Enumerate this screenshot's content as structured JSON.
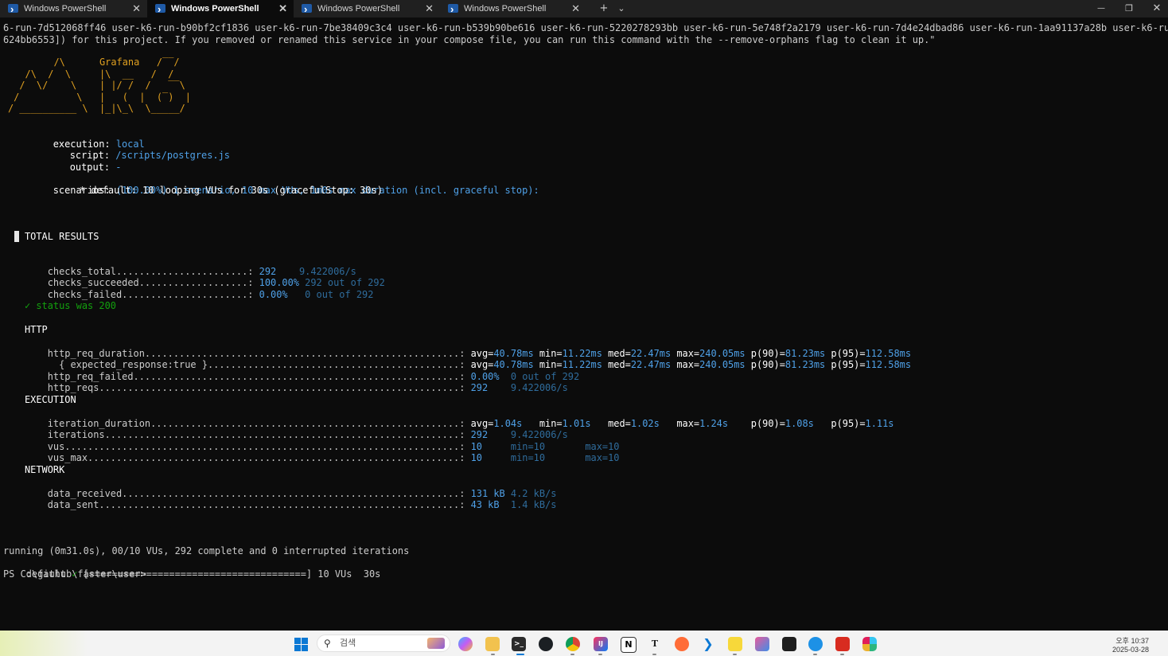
{
  "tabs": [
    {
      "title": "Windows PowerShell",
      "icon": "powershell-icon"
    },
    {
      "title": "Windows PowerShell",
      "icon": "powershell-icon"
    },
    {
      "title": "Windows PowerShell",
      "icon": "powershell-icon"
    },
    {
      "title": "Windows PowerShell",
      "icon": "powershell-icon"
    }
  ],
  "tabbar": {
    "new_tab": "+",
    "dropdown": "⌄",
    "minimize": "—",
    "restore": "❐",
    "close": "✕",
    "tab_close": "✕"
  },
  "terminal": {
    "warning_line1": "6-run-7d512068ff46 user-k6-run-b90bf2cf1836 user-k6-run-7be38409c3c4 user-k6-run-b539b90be616 user-k6-run-5220278293bb user-k6-run-5e748f2a2179 user-k6-run-7d4e24dbad86 user-k6-run-1aa91137a28b user-k6-run-fec",
    "warning_line2": "624bb6553]) for this project. If you removed or renamed this service in your compose file, you can run this command with the --remove-orphans flag to clean it up.\"",
    "logo": [
      "        /\\      Grafana   /‾‾/",
      "   /\\  /  \\     |\\  __   /  /",
      "  /  \\/    \\    | |/ /  /   ‾‾\\",
      " /          \\   |   (  |  (‾)  |",
      "/ __________ \\  |_|\\_\\  \\_____/"
    ],
    "execution_label": "execution:",
    "execution_value": "local",
    "script_label": "script:",
    "script_value": "/scripts/postgres.js",
    "output_label": "output:",
    "output_value": "-",
    "scenarios_label": "scenarios:",
    "scenarios_value": "(100.00%) 1 scenario, 10 max VUs, 1m0s max duration (incl. graceful stop):",
    "scenario_default": "* default: 10 looping VUs for 30s (gracefulStop: 30s)",
    "total_results": "TOTAL RESULTS",
    "checks": [
      {
        "name": "checks_total.......................:",
        "value": "292",
        "extra": "    9.422006/s"
      },
      {
        "name": "checks_succeeded...................:",
        "value": "100.00%",
        "extra": " 292 out of 292"
      },
      {
        "name": "checks_failed......................:",
        "value": "0.00%",
        "extra": "   0 out of 292"
      }
    ],
    "status_check": "✓ status was 200",
    "http_header": "HTTP",
    "http_req_duration_name": "http_req_duration.......................................................:",
    "expected_response_name": "  { expected_response:true }............................................:",
    "http_req_duration_stats": {
      "avg": "40.78ms",
      "min": "11.22ms",
      "med": "22.47ms",
      "max": "240.05ms",
      "p90": "81.23ms",
      "p95": "112.58ms"
    },
    "expected_response_stats": {
      "avg": "40.78ms",
      "min": "11.22ms",
      "med": "22.47ms",
      "max": "240.05ms",
      "p90": "81.23ms",
      "p95": "112.58ms"
    },
    "http_req_failed_name": "http_req_failed.........................................................:",
    "http_req_failed_value": "0.00%",
    "http_req_failed_extra": "  0 out of 292",
    "http_reqs_name": "http_reqs...............................................................:",
    "http_reqs_value": "292",
    "http_reqs_extra": "    9.422006/s",
    "execution_header": "EXECUTION",
    "iteration_duration_name": "iteration_duration......................................................:",
    "iteration_duration_stats": {
      "avg": "1.04s",
      "min": "1.01s",
      "med": "1.02s",
      "max": "1.24s",
      "p90": "1.08s",
      "p95": "1.11s"
    },
    "iterations_name": "iterations..............................................................:",
    "iterations_value": "292",
    "iterations_extra": "    9.422006/s",
    "vus_name": "vus.....................................................................:",
    "vus_value": "10",
    "vus_extra": "     min=10       max=10",
    "vus_max_name": "vus_max.................................................................:",
    "vus_max_value": "10",
    "vus_max_extra": "     min=10       max=10",
    "network_header": "NETWORK",
    "data_received_name": "data_received...........................................................:",
    "data_received_value": "131 kB",
    "data_received_extra": " 4.2 kB/s",
    "data_sent_name": "data_sent...............................................................:",
    "data_sent_value": "43 kB",
    "data_sent_extra": "  1.4 kB/s",
    "running_line": "running (0m31.0s), 00/10 VUs, 292 complete and 0 interrupted iterations",
    "progress_label": "default",
    "progress_check": "✓",
    "progress_bar": "[======================================]",
    "progress_tail": " 10 VUs  30s",
    "progress_fraction": 1.0,
    "prompt": "PS C:\\github\\faster\\user>"
  },
  "taskbar": {
    "search_placeholder": "검색",
    "apps": [
      "copilot-icon",
      "file-explorer-icon",
      "terminal-icon",
      "github-desktop-icon",
      "chrome-icon",
      "intellij-icon",
      "notion-icon",
      "typora-icon",
      "postman-icon",
      "vscode-icon",
      "sticky-notes-icon",
      "snipping-tool-icon",
      "figma-icon",
      "docker-icon",
      "redis-icon",
      "slack-icon"
    ],
    "app_glyphs": {
      "notion": "N",
      "typora": "T",
      "intellij": "IJ"
    },
    "time": "오후 10:37",
    "date": "2025-03-28"
  },
  "colors": {
    "terminal_bg": "#0c0c0c",
    "value_blue": "#4fa1e8",
    "dim_blue": "#2f6c9c",
    "check_green": "#13a10e",
    "logo_yellow": "#e0a020",
    "tab_active": "#0c0c0c",
    "tabbar_bg": "#202020"
  }
}
